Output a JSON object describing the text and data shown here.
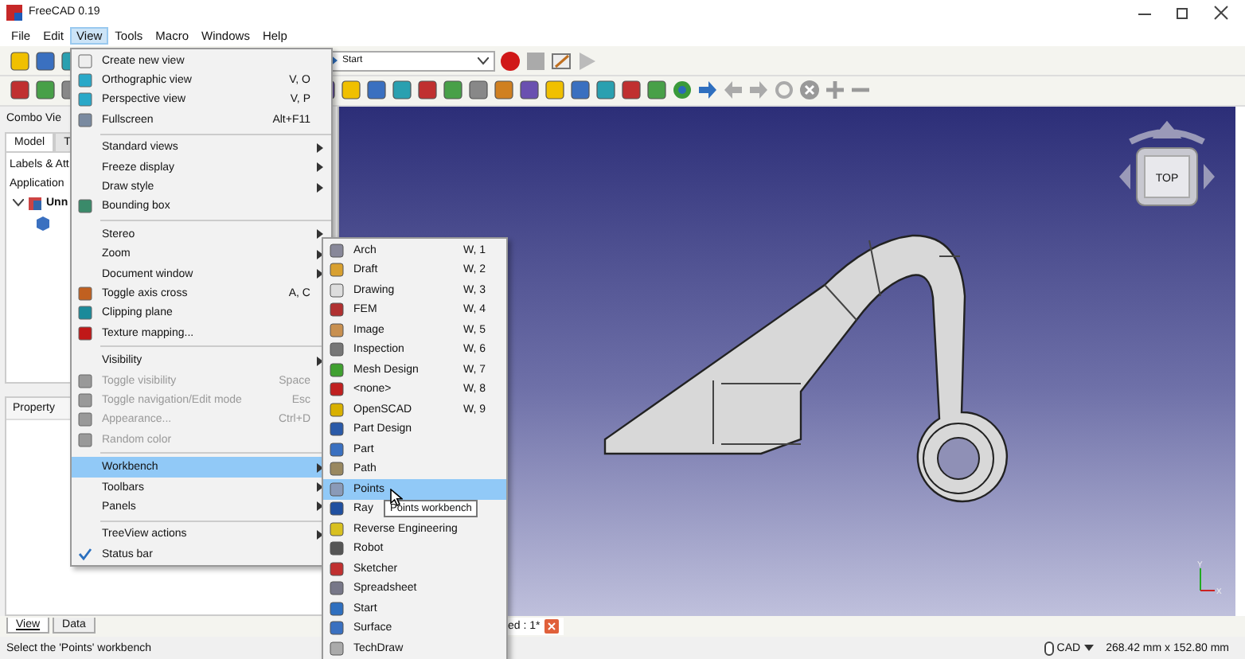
{
  "window": {
    "title": "FreeCAD 0.19"
  },
  "menubar": [
    {
      "label": "File",
      "selected": false
    },
    {
      "label": "Edit",
      "selected": false
    },
    {
      "label": "View",
      "selected": true
    },
    {
      "label": "Tools",
      "selected": false
    },
    {
      "label": "Macro",
      "selected": false
    },
    {
      "label": "Windows",
      "selected": false
    },
    {
      "label": "Help",
      "selected": false
    }
  ],
  "toolbar": {
    "workbench_dropdown": "Start"
  },
  "combo_view": {
    "title": "Combo Vie",
    "tabs": [
      {
        "label": "Model",
        "selected": true
      },
      {
        "label": "T",
        "selected": false
      }
    ],
    "tree_header": "Labels & Att",
    "tree_root": "Application",
    "tree_item": "Unn",
    "property_header": "Property",
    "bottom_tabs": [
      {
        "label": "View",
        "selected": true
      },
      {
        "label": "Data",
        "selected": false
      }
    ]
  },
  "view_menu": [
    {
      "kind": "item",
      "label": "Create new view",
      "has_icon": true
    },
    {
      "kind": "item",
      "label": "Orthographic view",
      "shortcut": "V, O",
      "has_icon": true
    },
    {
      "kind": "item",
      "label": "Perspective view",
      "shortcut": "V, P",
      "has_icon": true
    },
    {
      "kind": "item",
      "label": "Fullscreen",
      "shortcut": "Alt+F11",
      "has_icon": true
    },
    {
      "kind": "separator"
    },
    {
      "kind": "submenu",
      "label": "Standard views"
    },
    {
      "kind": "submenu",
      "label": "Freeze display"
    },
    {
      "kind": "submenu",
      "label": "Draw style"
    },
    {
      "kind": "item",
      "label": "Bounding box",
      "has_icon": true
    },
    {
      "kind": "separator"
    },
    {
      "kind": "submenu",
      "label": "Stereo"
    },
    {
      "kind": "submenu",
      "label": "Zoom"
    },
    {
      "kind": "submenu",
      "label": "Document window"
    },
    {
      "kind": "item",
      "label": "Toggle axis cross",
      "shortcut": "A, C",
      "has_icon": true
    },
    {
      "kind": "item",
      "label": "Clipping plane",
      "has_icon": true
    },
    {
      "kind": "item",
      "label": "Texture mapping...",
      "has_icon": true
    },
    {
      "kind": "separator"
    },
    {
      "kind": "submenu",
      "label": "Visibility"
    },
    {
      "kind": "item",
      "label": "Toggle visibility",
      "shortcut": "Space",
      "has_icon": true,
      "disabled": true
    },
    {
      "kind": "item",
      "label": "Toggle navigation/Edit mode",
      "shortcut": "Esc",
      "has_icon": true,
      "disabled": true
    },
    {
      "kind": "item",
      "label": "Appearance...",
      "shortcut": "Ctrl+D",
      "has_icon": true,
      "disabled": true
    },
    {
      "kind": "item",
      "label": "Random color",
      "has_icon": true,
      "disabled": true
    },
    {
      "kind": "separator"
    },
    {
      "kind": "submenu",
      "label": "Workbench",
      "selected": true
    },
    {
      "kind": "submenu",
      "label": "Toolbars"
    },
    {
      "kind": "submenu",
      "label": "Panels"
    },
    {
      "kind": "separator"
    },
    {
      "kind": "submenu",
      "label": "TreeView actions"
    },
    {
      "kind": "item",
      "label": "Status bar",
      "checked": true
    }
  ],
  "workbench_menu": [
    {
      "label": "Arch",
      "shortcut": "W, 1",
      "selected": false
    },
    {
      "label": "Draft",
      "shortcut": "W, 2",
      "selected": false
    },
    {
      "label": "Drawing",
      "shortcut": "W, 3",
      "selected": false
    },
    {
      "label": "FEM",
      "shortcut": "W, 4",
      "selected": false
    },
    {
      "label": "Image",
      "shortcut": "W, 5",
      "selected": false
    },
    {
      "label": "Inspection",
      "shortcut": "W, 6",
      "selected": false
    },
    {
      "label": "Mesh Design",
      "shortcut": "W, 7",
      "selected": false
    },
    {
      "label": "<none>",
      "shortcut": "W, 8",
      "selected": false
    },
    {
      "label": "OpenSCAD",
      "shortcut": "W, 9",
      "selected": false
    },
    {
      "label": "Part Design",
      "selected": false
    },
    {
      "label": "Part",
      "selected": false
    },
    {
      "label": "Path",
      "selected": false
    },
    {
      "label": "Points",
      "selected": true
    },
    {
      "label": "Ray",
      "selected": false
    },
    {
      "label": "Reverse Engineering",
      "selected": false
    },
    {
      "label": "Robot",
      "selected": false
    },
    {
      "label": "Sketcher",
      "selected": false
    },
    {
      "label": "Spreadsheet",
      "selected": false
    },
    {
      "label": "Start",
      "selected": false
    },
    {
      "label": "Surface",
      "selected": false
    },
    {
      "label": "TechDraw",
      "selected": false
    }
  ],
  "tooltip": "Points workbench",
  "viewport": {
    "nav_cube_face": "TOP",
    "axis_labels": [
      "Y",
      "X"
    ]
  },
  "document_tab": {
    "label": "ed : 1*"
  },
  "status_bar": {
    "message": "Select the 'Points' workbench",
    "navigation_style": "CAD",
    "dimensions": "268.42 mm x 152.80 mm"
  }
}
